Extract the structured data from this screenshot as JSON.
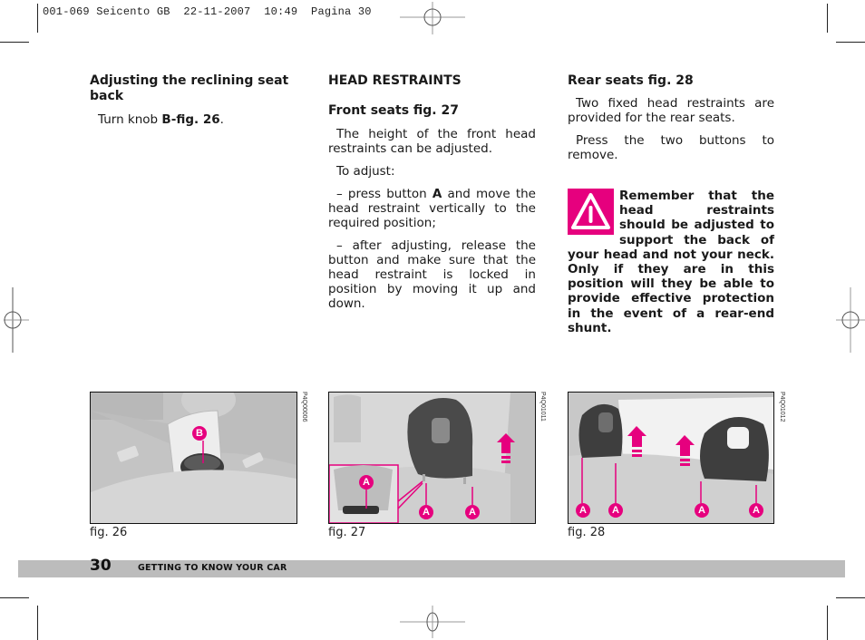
{
  "slug_line": "001-069 Seicento GB  22-11-2007  10:49  Pagina 30",
  "column1": {
    "heading": "Adjusting the reclining seat back",
    "body_prefix": "Turn knob ",
    "body_bold": "B-fig. 26",
    "body_suffix": "."
  },
  "column2": {
    "title": "HEAD RESTRAINTS",
    "subheading": "Front seats fig. 27",
    "para1": "The height of the front head restraints can be adjusted.",
    "para2": "To adjust:",
    "para3_prefix": "– press button ",
    "para3_bold": "A",
    "para3_suffix": " and move the head restraint vertically to the required position;",
    "para4": "– after adjusting, release the button and make sure that the head restraint is locked in position by moving it up and down."
  },
  "column3": {
    "subheading": "Rear seats fig. 28",
    "para1": "Two fixed head restraints are provided for the rear seats.",
    "para2": "Press the two buttons to remove.",
    "warning_icon": "warning-triangle-icon",
    "warning_text": "Remember that the head restraints should be adjusted to support the back of your head and not your neck. Only if they are in this position will they be able to provide effective protection in the event of a rear-end shunt.",
    "accent_color": "#e6007e"
  },
  "figures": [
    {
      "caption": "fig. 26",
      "code": "P4Q00006",
      "labels": [
        "B"
      ]
    },
    {
      "caption": "fig. 27",
      "code": "P4Q01011",
      "labels": [
        "A",
        "A",
        "A"
      ]
    },
    {
      "caption": "fig. 28",
      "code": "P4Q01012",
      "labels": [
        "A",
        "A",
        "A",
        "A"
      ]
    }
  ],
  "footer": {
    "page_number": "30",
    "section": "GETTING TO KNOW YOUR CAR"
  }
}
